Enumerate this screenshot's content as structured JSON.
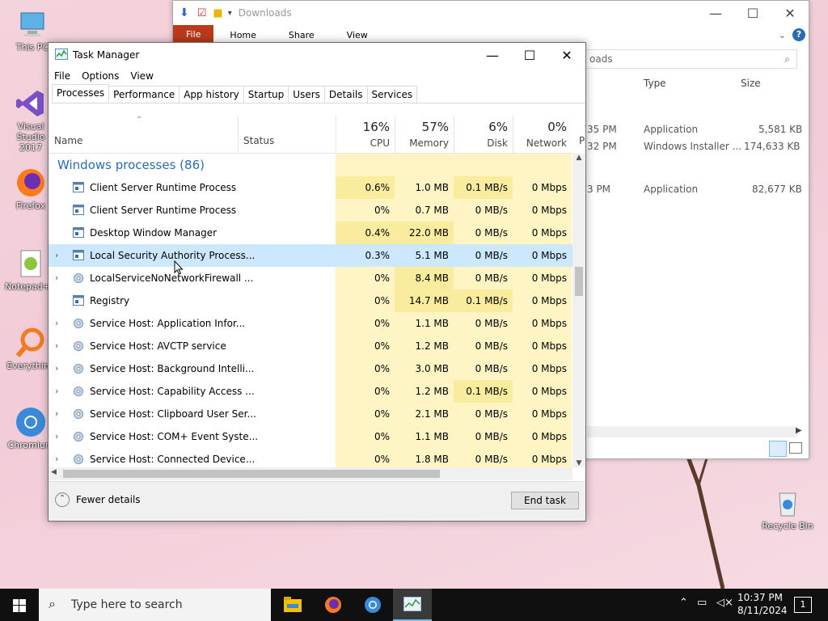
{
  "desktop": {
    "icons": [
      {
        "label": "This PC"
      },
      {
        "label": "Visual Studio 2017"
      },
      {
        "label": "Firefox"
      },
      {
        "label": "Notepad++"
      },
      {
        "label": "Everything"
      },
      {
        "label": "Chromium"
      },
      {
        "label": "Recycle Bin"
      }
    ]
  },
  "explorer": {
    "title": "Downloads",
    "ribbon": [
      "File",
      "Home",
      "Share",
      "View"
    ],
    "address_fragment": "oads",
    "columns": [
      "Type",
      "Size"
    ],
    "rows": [
      {
        "time": "35 PM",
        "type": "Application",
        "size": "5,581 KB"
      },
      {
        "time": "32 PM",
        "type": "Windows Installer ...",
        "size": "174,633 KB"
      },
      {
        "time": "3 PM",
        "type": "Application",
        "size": "82,677 KB"
      }
    ]
  },
  "taskmanager": {
    "title": "Task Manager",
    "menu": [
      "File",
      "Options",
      "View"
    ],
    "tabs": [
      "Processes",
      "Performance",
      "App history",
      "Startup",
      "Users",
      "Details",
      "Services"
    ],
    "headers": {
      "name": "Name",
      "status": "Status",
      "cpu": {
        "pct": "16%",
        "label": "CPU"
      },
      "memory": {
        "pct": "57%",
        "label": "Memory"
      },
      "disk": {
        "pct": "6%",
        "label": "Disk"
      },
      "network": {
        "pct": "0%",
        "label": "Network"
      },
      "power": "P"
    },
    "group": "Windows processes (86)",
    "processes": [
      {
        "name": "Client Server Runtime Process",
        "cpu": "0.6%",
        "mem": "1.0 MB",
        "disk": "0.1 MB/s",
        "net": "0 Mbps",
        "exp": false,
        "icon": "window"
      },
      {
        "name": "Client Server Runtime Process",
        "cpu": "0%",
        "mem": "0.7 MB",
        "disk": "0 MB/s",
        "net": "0 Mbps",
        "exp": false,
        "icon": "window"
      },
      {
        "name": "Desktop Window Manager",
        "cpu": "0.4%",
        "mem": "22.0 MB",
        "disk": "0 MB/s",
        "net": "0 Mbps",
        "exp": false,
        "icon": "window"
      },
      {
        "name": "Local Security Authority Process...",
        "cpu": "0.3%",
        "mem": "5.1 MB",
        "disk": "0 MB/s",
        "net": "0 Mbps",
        "exp": true,
        "icon": "window",
        "selected": true
      },
      {
        "name": "LocalServiceNoNetworkFirewall ...",
        "cpu": "0%",
        "mem": "8.4 MB",
        "disk": "0 MB/s",
        "net": "0 Mbps",
        "exp": true,
        "icon": "gear"
      },
      {
        "name": "Registry",
        "cpu": "0%",
        "mem": "14.7 MB",
        "disk": "0.1 MB/s",
        "net": "0 Mbps",
        "exp": false,
        "icon": "window"
      },
      {
        "name": "Service Host: Application Infor...",
        "cpu": "0%",
        "mem": "1.1 MB",
        "disk": "0 MB/s",
        "net": "0 Mbps",
        "exp": true,
        "icon": "gear"
      },
      {
        "name": "Service Host: AVCTP service",
        "cpu": "0%",
        "mem": "1.2 MB",
        "disk": "0 MB/s",
        "net": "0 Mbps",
        "exp": true,
        "icon": "gear"
      },
      {
        "name": "Service Host: Background Intelli...",
        "cpu": "0%",
        "mem": "3.0 MB",
        "disk": "0 MB/s",
        "net": "0 Mbps",
        "exp": true,
        "icon": "gear"
      },
      {
        "name": "Service Host: Capability Access ...",
        "cpu": "0%",
        "mem": "1.2 MB",
        "disk": "0.1 MB/s",
        "net": "0 Mbps",
        "exp": true,
        "icon": "gear"
      },
      {
        "name": "Service Host: Clipboard User Ser...",
        "cpu": "0%",
        "mem": "2.1 MB",
        "disk": "0 MB/s",
        "net": "0 Mbps",
        "exp": true,
        "icon": "gear"
      },
      {
        "name": "Service Host: COM+ Event Syste...",
        "cpu": "0%",
        "mem": "1.1 MB",
        "disk": "0 MB/s",
        "net": "0 Mbps",
        "exp": true,
        "icon": "gear"
      },
      {
        "name": "Service Host: Connected Device...",
        "cpu": "0%",
        "mem": "1.8 MB",
        "disk": "0 MB/s",
        "net": "0 Mbps",
        "exp": true,
        "icon": "gear"
      }
    ],
    "fewer_details": "Fewer details",
    "end_task": "End task"
  },
  "taskbar": {
    "search_placeholder": "Type here to search",
    "time": "10:37 PM",
    "date": "8/11/2024",
    "notification_count": "1"
  },
  "colors": {
    "accent": "#2a6bb8",
    "heat_light": "#fff4c4",
    "heat_dark": "#f9ec9f",
    "selected": "#cce8ff",
    "taskbar": "#101010"
  }
}
